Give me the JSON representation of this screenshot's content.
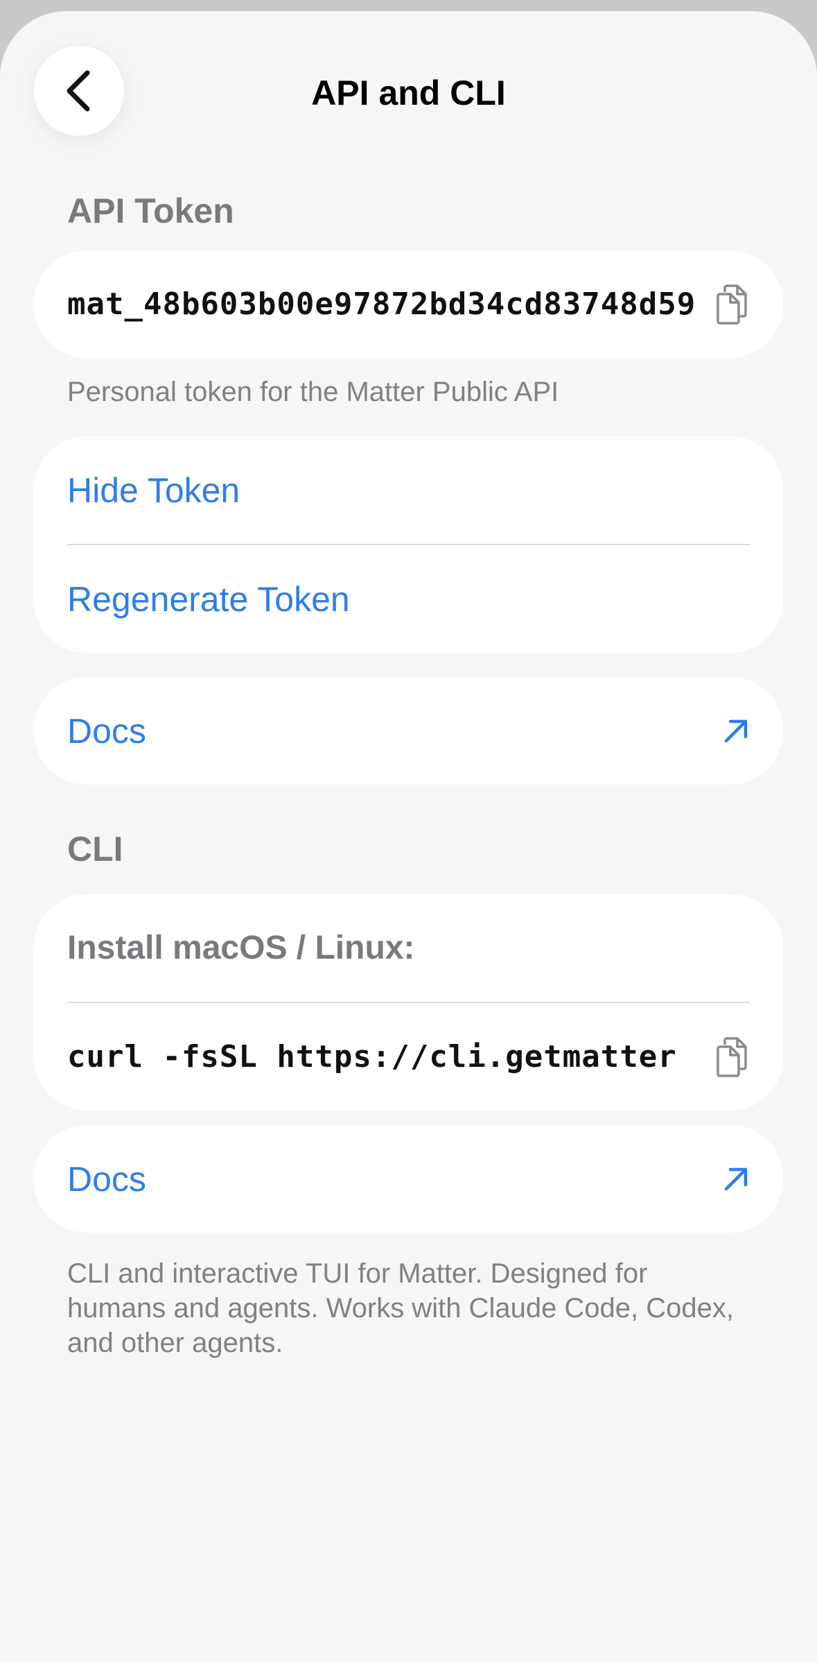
{
  "header": {
    "title": "API and CLI",
    "back_icon": "chevron-left-icon"
  },
  "api_section": {
    "heading": "API Token",
    "token_value": "mat_48b603b00e97872bd34cd83748d59",
    "copy_icon": "copy-icon",
    "caption": "Personal token for the Matter Public API",
    "hide_label": "Hide Token",
    "regenerate_label": "Regenerate Token",
    "docs_label": "Docs",
    "docs_icon": "arrow-up-right-icon"
  },
  "cli_section": {
    "heading": "CLI",
    "install_label": "Install macOS / Linux:",
    "command": "curl -fsSL https://cli.getmatter",
    "copy_icon": "copy-icon",
    "docs_label": "Docs",
    "docs_icon": "arrow-up-right-icon",
    "caption": "CLI and interactive TUI for Matter. Designed for humans and agents. Works with Claude Code, Codex, and other agents."
  },
  "colors": {
    "accent": "#2f7ee6",
    "background": "#f6f6f7",
    "card": "#ffffff",
    "muted_text": "#7a7a7e"
  }
}
